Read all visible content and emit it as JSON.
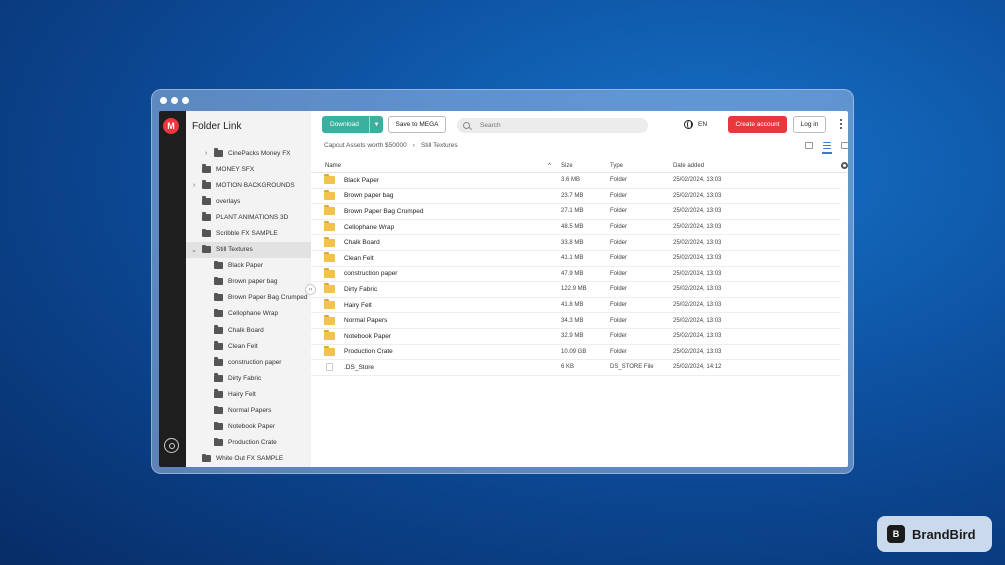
{
  "app": {
    "title": "Folder Link",
    "logo_letter": "M",
    "accent": "#e8383d",
    "download_color": "#3ab09e"
  },
  "sidebar": {
    "items": [
      {
        "label": "CinePacks Money FX",
        "level": 1,
        "chevron": "›",
        "active": false
      },
      {
        "label": "MONEY SFX",
        "level": 0,
        "chevron": "",
        "active": false
      },
      {
        "label": "MOTION BACKGROUNDS",
        "level": 0,
        "chevron": "›",
        "active": false
      },
      {
        "label": "overlays",
        "level": 0,
        "chevron": "",
        "active": false
      },
      {
        "label": "PLANT ANIMATIONS 3D",
        "level": 0,
        "chevron": "",
        "active": false
      },
      {
        "label": "Scribble FX SAMPLE",
        "level": 0,
        "chevron": "",
        "active": false
      },
      {
        "label": "Still Textures",
        "level": 0,
        "chevron": "⌄",
        "active": true
      },
      {
        "label": "Black Paper",
        "level": 1,
        "chevron": "",
        "active": false
      },
      {
        "label": "Brown paper bag",
        "level": 1,
        "chevron": "",
        "active": false
      },
      {
        "label": "Brown Paper Bag Crumped",
        "level": 1,
        "chevron": "",
        "active": false
      },
      {
        "label": "Cellophane Wrap",
        "level": 1,
        "chevron": "",
        "active": false
      },
      {
        "label": "Chalk Board",
        "level": 1,
        "chevron": "",
        "active": false
      },
      {
        "label": "Clean Felt",
        "level": 1,
        "chevron": "",
        "active": false
      },
      {
        "label": "construction paper",
        "level": 1,
        "chevron": "",
        "active": false
      },
      {
        "label": "Dirty Fabric",
        "level": 1,
        "chevron": "",
        "active": false
      },
      {
        "label": "Hairy Felt",
        "level": 1,
        "chevron": "",
        "active": false
      },
      {
        "label": "Normal Papers",
        "level": 1,
        "chevron": "",
        "active": false
      },
      {
        "label": "Notebook Paper",
        "level": 1,
        "chevron": "",
        "active": false
      },
      {
        "label": "Production Crate",
        "level": 1,
        "chevron": "",
        "active": false
      },
      {
        "label": "White Out FX SAMPLE",
        "level": 0,
        "chevron": "",
        "active": false
      }
    ],
    "collapse_glyph": "‹‹"
  },
  "toolbar": {
    "download_label": "Download",
    "save_label": "Save to MEGA",
    "search_placeholder": "Search",
    "lang": "EN",
    "create_label": "Create account",
    "login_label": "Log in"
  },
  "breadcrumb": {
    "root": "Capcut Assets worth $50000",
    "sep": "›",
    "current": "Still Textures"
  },
  "table": {
    "headers": {
      "name": "Name",
      "size": "Size",
      "type": "Type",
      "date": "Date added"
    },
    "sort_glyph": "^",
    "rows": [
      {
        "name": "Black Paper",
        "size": "3.6 MB",
        "type": "Folder",
        "date": "25/02/2024, 13:03",
        "kind": "folder"
      },
      {
        "name": "Brown paper bag",
        "size": "23.7 MB",
        "type": "Folder",
        "date": "25/02/2024, 13:03",
        "kind": "folder"
      },
      {
        "name": "Brown Paper Bag Crumped",
        "size": "27.1 MB",
        "type": "Folder",
        "date": "25/02/2024, 13:03",
        "kind": "folder"
      },
      {
        "name": "Cellophane Wrap",
        "size": "48.5 MB",
        "type": "Folder",
        "date": "25/02/2024, 13:03",
        "kind": "folder"
      },
      {
        "name": "Chalk Board",
        "size": "33.8 MB",
        "type": "Folder",
        "date": "25/02/2024, 13:03",
        "kind": "folder"
      },
      {
        "name": "Clean Felt",
        "size": "41.1 MB",
        "type": "Folder",
        "date": "25/02/2024, 13:03",
        "kind": "folder"
      },
      {
        "name": "construction paper",
        "size": "47.9 MB",
        "type": "Folder",
        "date": "25/02/2024, 13:03",
        "kind": "folder"
      },
      {
        "name": "Dirty Fabric",
        "size": "122.9 MB",
        "type": "Folder",
        "date": "25/02/2024, 13:03",
        "kind": "folder"
      },
      {
        "name": "Hairy Felt",
        "size": "41.8 MB",
        "type": "Folder",
        "date": "25/02/2024, 13:03",
        "kind": "folder"
      },
      {
        "name": "Normal Papers",
        "size": "34.3 MB",
        "type": "Folder",
        "date": "25/02/2024, 13:03",
        "kind": "folder"
      },
      {
        "name": "Notebook Paper",
        "size": "32.9 MB",
        "type": "Folder",
        "date": "25/02/2024, 13:03",
        "kind": "folder"
      },
      {
        "name": "Production Crate",
        "size": "10.09 GB",
        "type": "Folder",
        "date": "25/02/2024, 13:03",
        "kind": "folder"
      },
      {
        "name": ".DS_Store",
        "size": "6 KB",
        "type": "DS_STORE File",
        "date": "25/02/2024, 14:12",
        "kind": "file"
      }
    ]
  },
  "brand": {
    "name": "BrandBird",
    "icon_letter": "B"
  }
}
